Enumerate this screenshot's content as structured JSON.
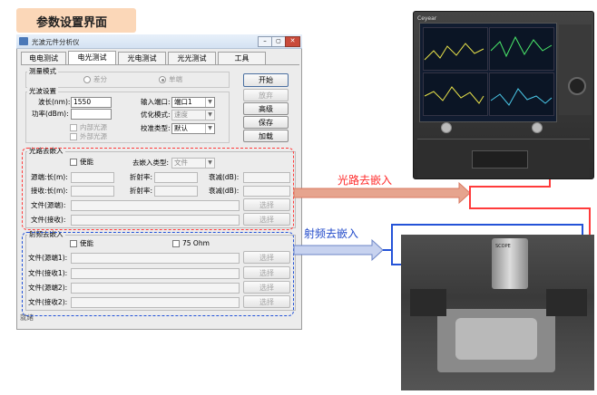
{
  "badge": {
    "title": "参数设置界面"
  },
  "window": {
    "title": "光波元件分析仪",
    "tabs": [
      "电电测试",
      "电光测试",
      "光电测试",
      "光光测试",
      "工具"
    ],
    "measure_mode": {
      "label": "测量模式",
      "options": [
        {
          "label": "差分",
          "selected": false
        },
        {
          "label": "单端",
          "selected": true
        }
      ]
    },
    "buttons": {
      "start": "开始",
      "abort": "放弃",
      "advanced": "高级",
      "save": "保存",
      "load": "加载"
    },
    "light_settings": {
      "label": "光波设置",
      "wavelength_label": "波长(nm):",
      "wavelength_value": "1550",
      "power_label": "功率(dBm):",
      "input_port_label": "输入端口:",
      "input_port_value": "端口1",
      "optimize_label": "优化模式:",
      "optimize_value": "速度",
      "calib_label": "校准类型:",
      "calib_value": "默认",
      "internal_source": "内部光源",
      "external_source": "外部光源"
    },
    "optical_deembed": {
      "label": "光路去嵌入",
      "enable": "使能",
      "type_label": "去嵌入类型:",
      "type_value": "文件",
      "source_len": "源端:长(m):",
      "receive_len": "接收:长(m):",
      "refr1": "折射率:",
      "refr2": "折射率:",
      "atten1": "衰减(dB):",
      "atten2": "衰减(dB):",
      "file_src": "文件(源端):",
      "file_rcv": "文件(接收):",
      "select": "选择"
    },
    "rf_deembed": {
      "label": "射频去嵌入",
      "enable": "使能",
      "ohm": "75 Ohm",
      "files": [
        "文件(源端1):",
        "文件(接收1):",
        "文件(源端2):",
        "文件(接收2):"
      ],
      "select": "选择"
    },
    "status": "就绪"
  },
  "annotations": {
    "optical": "光路去嵌入",
    "rf": "射频去嵌入"
  },
  "instrument": {
    "brand": "Ceyear",
    "right_label": "SCOPE"
  },
  "colors": {
    "red": "#ff3b3b",
    "blue": "#2453d8",
    "arrow_fill": "#e6a48e",
    "badge": "#fbd7b8"
  }
}
